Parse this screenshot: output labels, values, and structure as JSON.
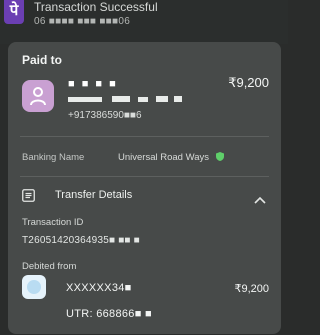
{
  "notification": {
    "app_logo_glyph": "पे",
    "title": "Transaction Successful",
    "subtitle": "06 ■■■■ ■■■ ■■■06"
  },
  "card": {
    "paid_to_label": "Paid to",
    "payee": {
      "name": "■ ■ ■ ■",
      "phone": "+917386590■■6",
      "amount": "₹9,200"
    },
    "banking_name_label": "Banking Name",
    "banking_name_value": "Universal Road Ways",
    "transfer_details_label": "Transfer Details",
    "transaction_id_label": "Transaction ID",
    "transaction_id_value": "T26051420364935■ ■■ ■",
    "debited_from_label": "Debited from",
    "account_masked": "XXXXXX34■",
    "debit_amount": "₹9,200",
    "utr_label": "UTR: 668866■ ■",
    "colors": {
      "avatar_bg": "#c9a0d2",
      "verified_green": "#5fcf6a",
      "card_bg": "#474a49",
      "brand_purple": "#6b3fb3"
    },
    "icons": [
      "person-avatar-icon",
      "verified-shield-icon",
      "document-icon",
      "chevron-up-icon",
      "bank-icon"
    ]
  }
}
